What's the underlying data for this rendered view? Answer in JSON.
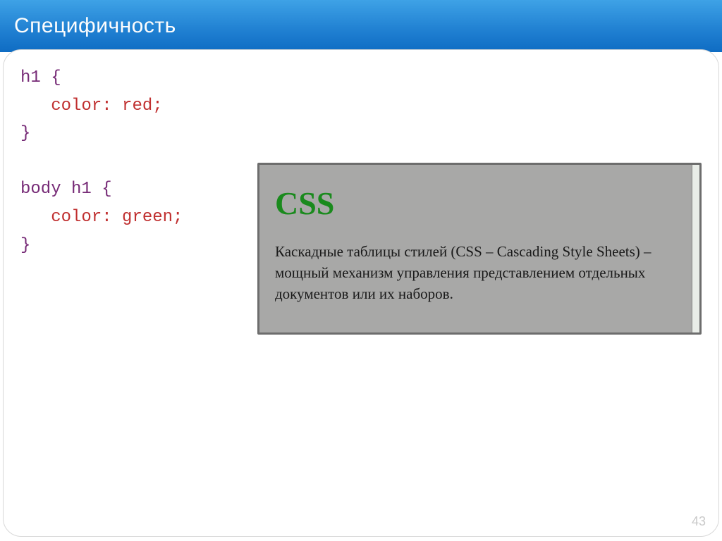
{
  "slide": {
    "title": "Специфичность",
    "page_number": "43"
  },
  "code": {
    "rule1_selector": "h1",
    "rule1_declaration": "color: red;",
    "rule2_selector": "body h1",
    "rule2_declaration": "color: green;",
    "open_brace": "{",
    "close_brace": "}"
  },
  "example": {
    "heading": "CSS",
    "paragraph": "Каскадные таблицы стилей (CSS – Cascading Style Sheets) – мощный механизм управления представлением отдельных документов или их наборов."
  }
}
